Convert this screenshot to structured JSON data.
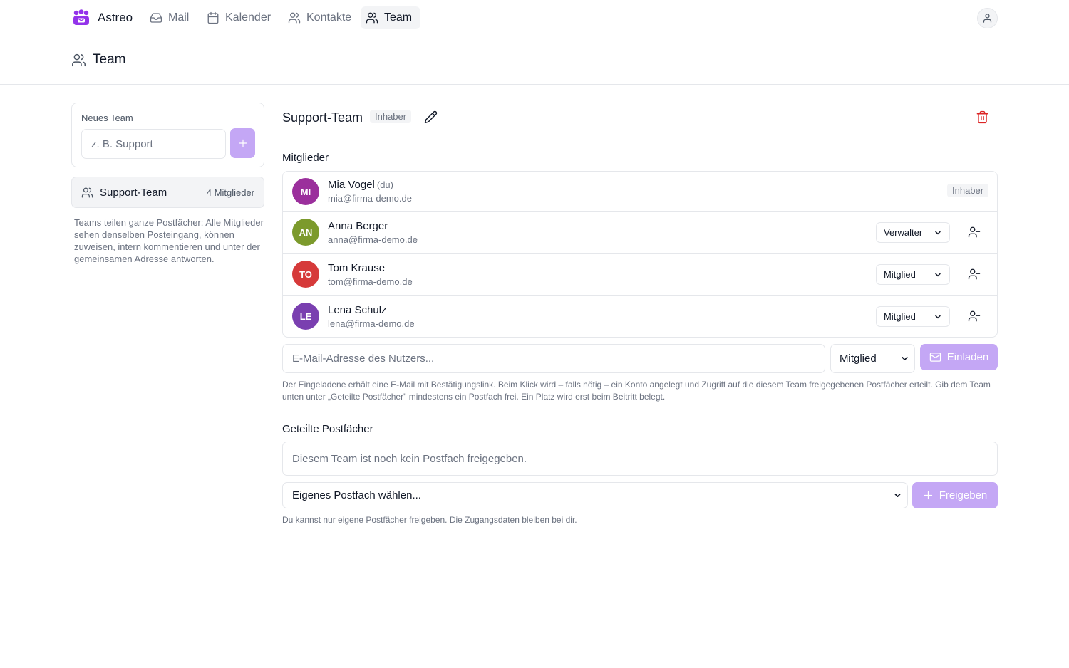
{
  "app": {
    "name": "Astreo"
  },
  "nav": {
    "items": [
      {
        "label": "Mail",
        "icon": "inbox-icon"
      },
      {
        "label": "Kalender",
        "icon": "calendar-icon"
      },
      {
        "label": "Kontakte",
        "icon": "users-icon"
      },
      {
        "label": "Team",
        "icon": "users-icon",
        "active": true
      }
    ]
  },
  "page": {
    "title": "Team"
  },
  "sidebar": {
    "new_team_label": "Neues Team",
    "new_team_placeholder": "z. B. Support",
    "teams": [
      {
        "name": "Support-Team",
        "count": "4 Mitglieder"
      }
    ],
    "help": "Teams teilen ganze Postfächer: Alle Mitglieder sehen denselben Posteingang, können zuweisen, intern kommentieren und unter der gemeinsamen Adresse antworten."
  },
  "team": {
    "name": "Support-Team",
    "role_badge": "Inhaber",
    "members_title": "Mitglieder",
    "members": [
      {
        "initials": "MI",
        "name": "Mia Vogel",
        "you": "(du)",
        "email": "mia@firma-demo.de",
        "role": "Inhaber",
        "color": "#9b2f9c"
      },
      {
        "initials": "AN",
        "name": "Anna Berger",
        "email": "anna@firma-demo.de",
        "role": "Verwalter",
        "color": "#7c9a2c"
      },
      {
        "initials": "TO",
        "name": "Tom Krause",
        "email": "tom@firma-demo.de",
        "role": "Mitglied",
        "color": "#d63a3a"
      },
      {
        "initials": "LE",
        "name": "Lena Schulz",
        "email": "lena@firma-demo.de",
        "role": "Mitglied",
        "color": "#7a3fb0"
      }
    ],
    "invite": {
      "placeholder": "E-Mail-Adresse des Nutzers...",
      "role": "Mitglied",
      "button": "Einladen",
      "help": "Der Eingeladene erhält eine E-Mail mit Bestätigungslink. Beim Klick wird – falls nötig – ein Konto angelegt und Zugriff auf die diesem Team freigegebenen Postfächer erteilt. Gib dem Team unten unter „Geteilte Postfächer\" mindestens ein Postfach frei. Ein Platz wird erst beim Beitritt belegt."
    },
    "shared": {
      "title": "Geteilte Postfächer",
      "empty": "Diesem Team ist noch kein Postfach freigegeben.",
      "select_placeholder": "Eigenes Postfach wählen...",
      "button": "Freigeben",
      "help": "Du kannst nur eigene Postfächer freigeben. Die Zugangsdaten bleiben bei dir."
    }
  },
  "colors": {
    "accent": "#c4a7f5",
    "brand": "#9333ea",
    "danger": "#dc2626"
  }
}
